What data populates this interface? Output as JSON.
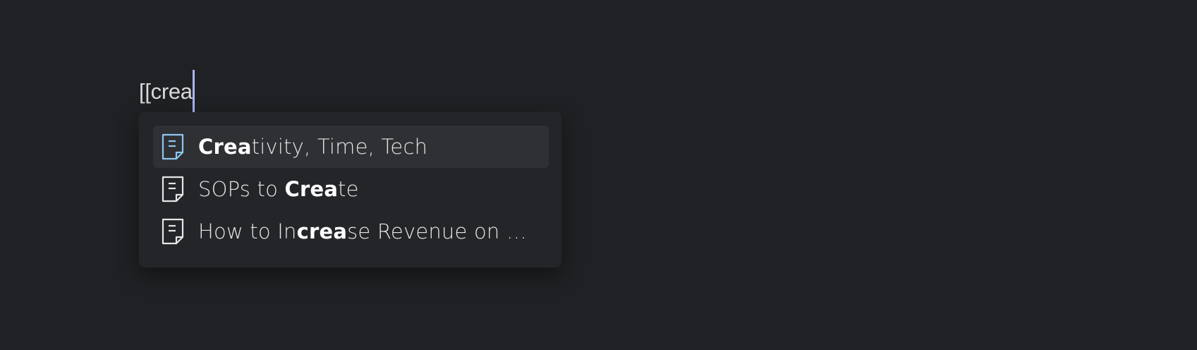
{
  "editor": {
    "typed_text": "[[crea"
  },
  "suggestions": {
    "items": [
      {
        "selected": true,
        "icon": "document-icon",
        "parts": [
          {
            "text": "Crea",
            "match": true
          },
          {
            "text": "tivity, Time, Tech",
            "match": false
          }
        ]
      },
      {
        "selected": false,
        "icon": "document-icon",
        "parts": [
          {
            "text": "SOPs to ",
            "match": false
          },
          {
            "text": "Crea",
            "match": true
          },
          {
            "text": "te",
            "match": false
          }
        ]
      },
      {
        "selected": false,
        "icon": "document-icon",
        "parts": [
          {
            "text": "How to In",
            "match": false
          },
          {
            "text": "crea",
            "match": true
          },
          {
            "text": "se Revenue on T…",
            "match": false
          }
        ]
      }
    ]
  },
  "colors": {
    "background": "#202124",
    "popup": "#242528",
    "selected_row": "#2f3034",
    "caret": "#a9b5f5",
    "icon_selected": "#8ec7ee",
    "icon_default": "#e6e6e8"
  }
}
